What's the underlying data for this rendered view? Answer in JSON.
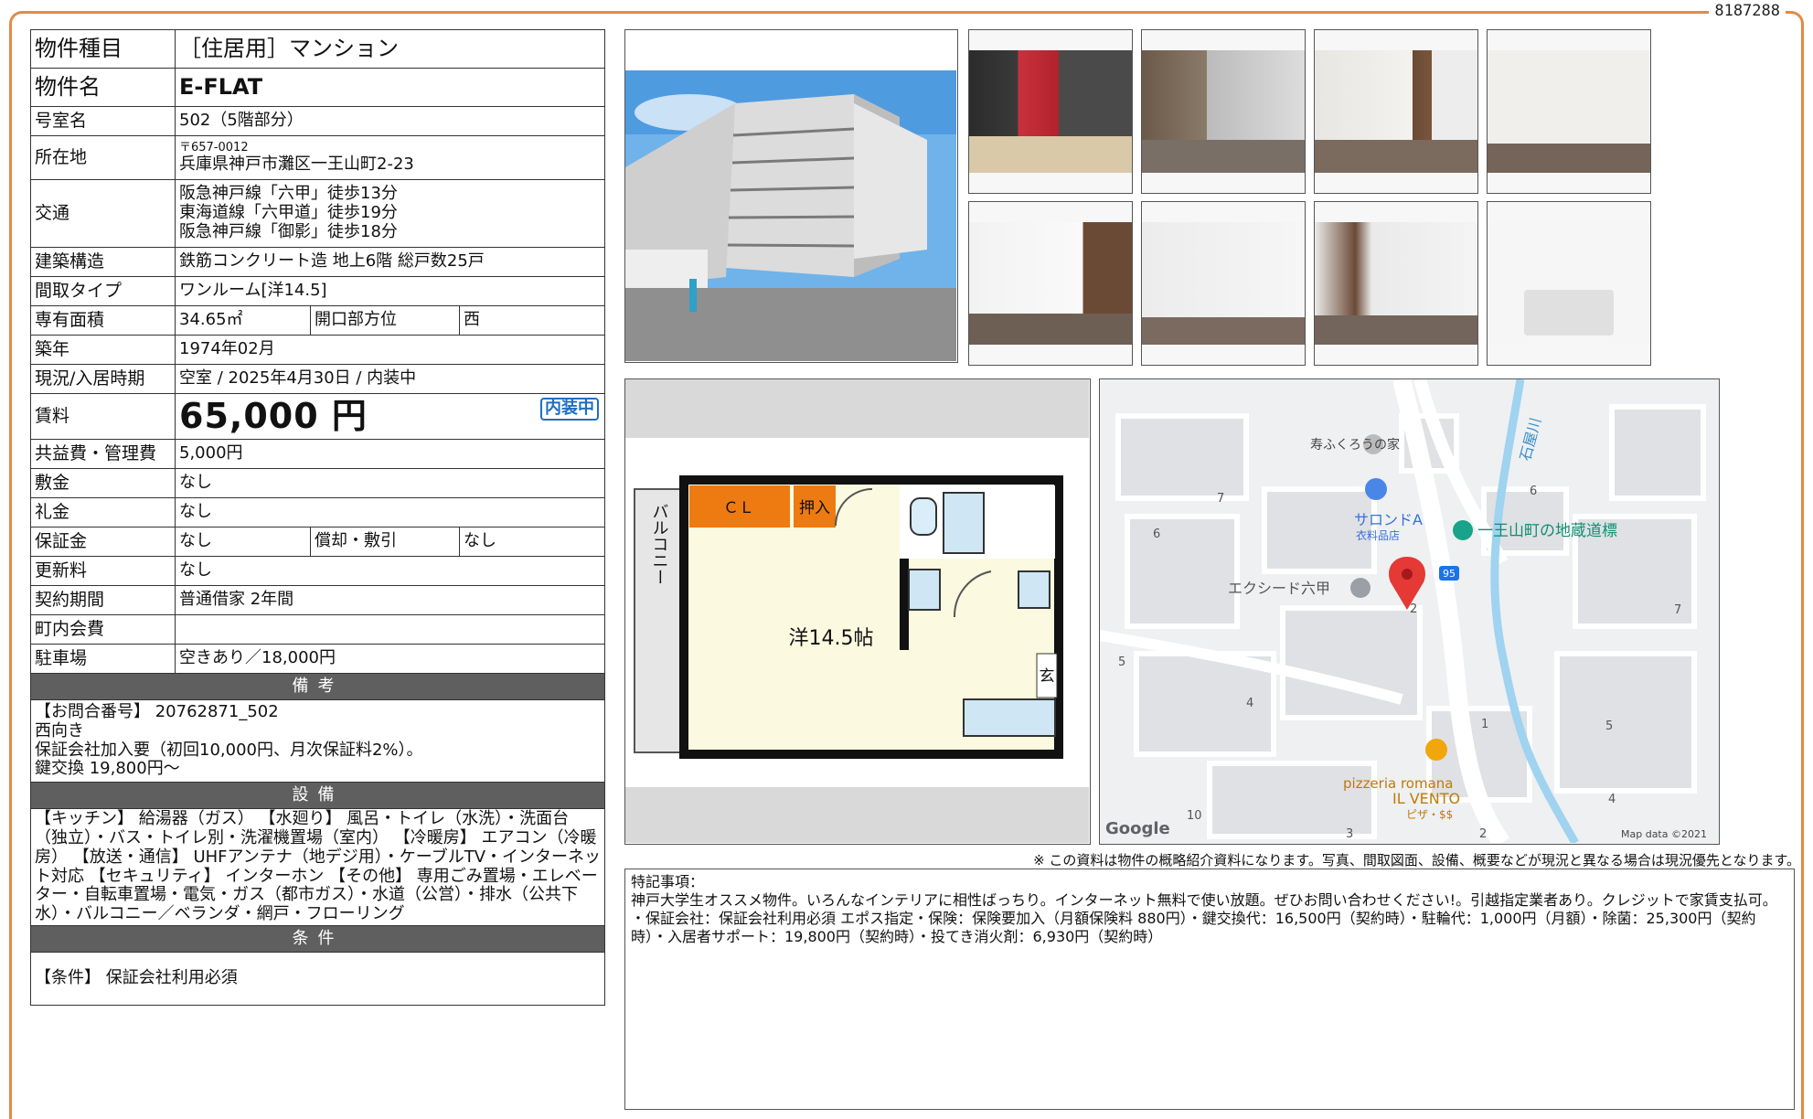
{
  "doc_id": "8187288",
  "spec": {
    "type_label": "物件種目",
    "type_value": "［住居用］マンション",
    "name_label": "物件名",
    "name_value": "E-FLAT",
    "room_label": "号室名",
    "room_value": "502（5階部分）",
    "address_label": "所在地",
    "address_zip": "〒657-0012",
    "address_value": "兵庫県神戸市灘区一王山町2-23",
    "access_label": "交通",
    "access_1": "阪急神戸線「六甲」徒歩13分",
    "access_2": "東海道線「六甲道」徒歩19分",
    "access_3": "阪急神戸線「御影」徒歩18分",
    "structure_label": "建築構造",
    "structure_value": "鉄筋コンクリート造 地上6階 総戸数25戸",
    "layout_label": "間取タイプ",
    "layout_value": "ワンルーム[洋14.5]",
    "area_label": "専有面積",
    "area_value": "34.65㎡",
    "direction_label": "開口部方位",
    "direction_value": "西",
    "built_label": "築年",
    "built_value": "1974年02月",
    "status_label": "現況/入居時期",
    "status_value": "空室 / 2025年4月30日 / 内装中",
    "rent_label": "賃料",
    "rent_value": "65,000 円",
    "badge": "内装中",
    "fee_label": "共益費・管理費",
    "fee_value": "5,000円",
    "deposit_label": "敷金",
    "deposit_value": "なし",
    "keymoney_label": "礼金",
    "keymoney_value": "なし",
    "guarantee_label": "保証金",
    "guarantee_value": "なし",
    "amort_label": "償却・敷引",
    "amort_value": "なし",
    "renewal_label": "更新料",
    "renewal_value": "なし",
    "contract_label": "契約期間",
    "contract_value": "普通借家 2年間",
    "assoc_label": "町内会費",
    "assoc_value": "",
    "parking_label": "駐車場",
    "parking_value": "空きあり／18,000円"
  },
  "notes": {
    "title": "備考",
    "line1": "【お問合番号】 20762871_502",
    "line2": "西向き",
    "line3": "保証会社加入要（初回10,000円、月次保証料2%）。",
    "line4": "鍵交換 19,800円～"
  },
  "facilities": {
    "title": "設備",
    "text": "【キッチン】 給湯器（ガス） 【水廻り】 風呂・トイレ（水洗）・洗面台（独立）・バス・トイレ別・洗濯機置場（室内） 【冷暖房】 エアコン（冷暖房） 【放送・通信】 UHFアンテナ（地デジ用）・ケーブルTV・インターネット対応 【セキュリティ】 インターホン 【その他】 専用ごみ置場・エレベーター・自転車置場・電気・ガス（都市ガス）・水道（公営）・排水（公共下水）・バルコニー／ベランダ・網戸・フローリング"
  },
  "conditions": {
    "title": "条件",
    "text": "【条件】 保証会社利用必須"
  },
  "floorplan": {
    "cl": "ＣＬ",
    "oshiire": "押入",
    "room": "洋14.5帖",
    "balcony": "バルコニー",
    "entrance": "玄"
  },
  "map": {
    "label_kotobuki": "寿ふくろうの家",
    "label_salon": "サロンドA",
    "label_salon_sub": "衣料品店",
    "label_jizo": "一王山町の地蔵道標",
    "label_excede": "エクシード六甲",
    "label_river": "石屋川",
    "label_pizza1": "pizzeria romana",
    "label_pizza2": "IL VENTO",
    "label_pizza3": "ピザ・$$",
    "route": "95",
    "google": "Google",
    "credit": "Map data ©2021",
    "n1": "7",
    "n2": "6",
    "n3": "6",
    "n4": "7",
    "n5": "5",
    "n6": "4",
    "n7": "2",
    "n8": "1",
    "n9": "5",
    "n10": "4",
    "n11": "10",
    "n12": "3",
    "n13": "2"
  },
  "disclaimer": "※ この資料は物件の概略紹介資料になります。写真、間取図面、設備、概要などが現況と異なる場合は現況優先となります。",
  "remarks": {
    "title": "特記事項：",
    "line1": "神戸大学生オススメ物件。いろんなインテリアに相性ばっちり。インターネット無料で使い放題。ぜひお問い合わせください!。引越指定業者あり。クレジットで家賃支払可。",
    "line2": "・保証会社：保証会社利用必須 エポス指定・保険：保険要加入（月額保険料 880円）・鍵交換代：16,500円（契約時）・駐輪代：1,000円（月額）・除菌：25,300円（契約時）・入居者サポート：19,800円（契約時）・投てき消火剤：6,930円（契約時）"
  }
}
